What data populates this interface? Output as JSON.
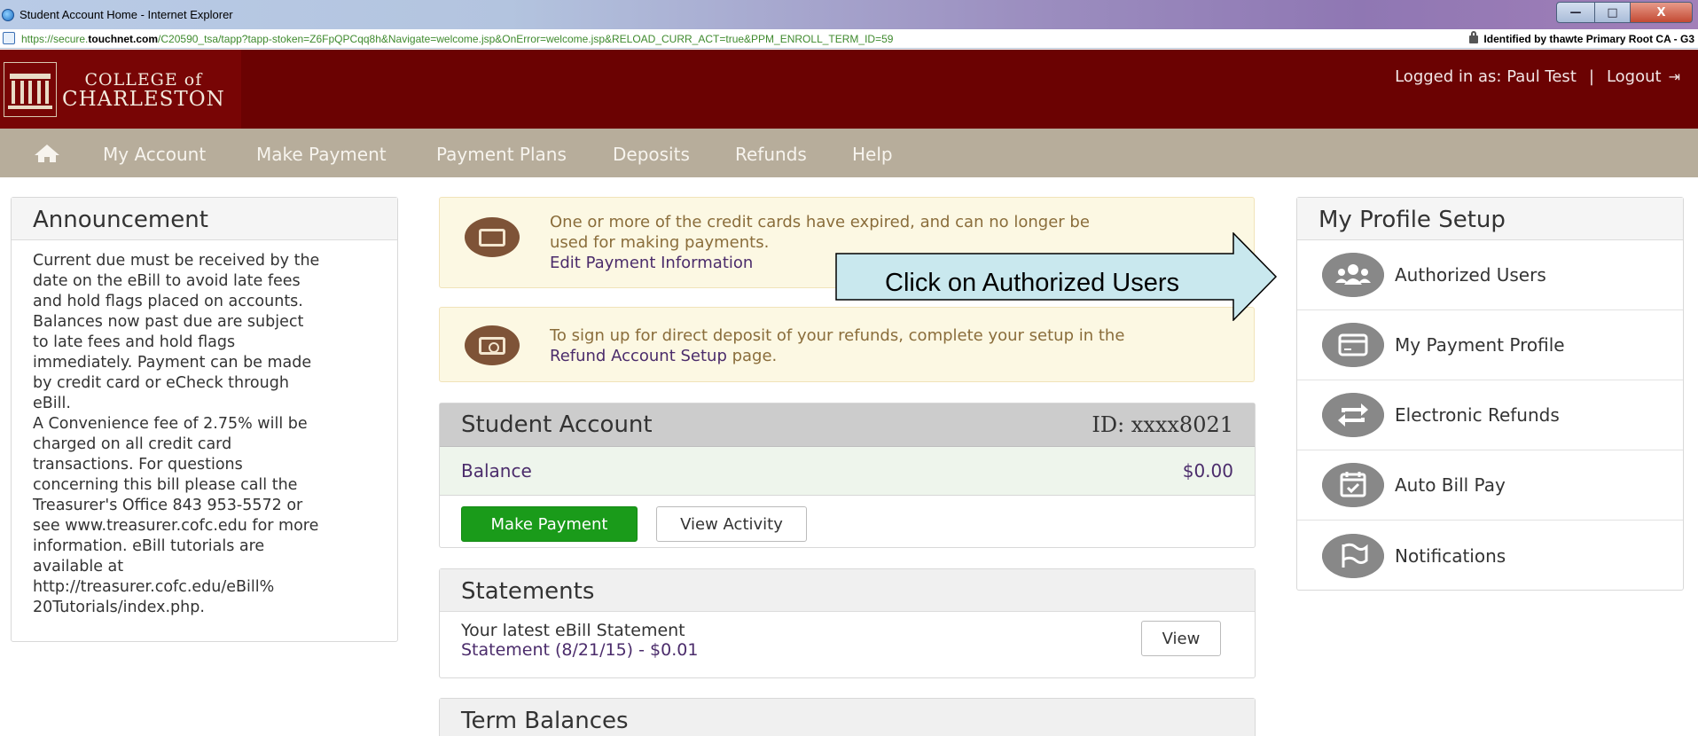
{
  "window": {
    "title": "Student Account Home - Internet Explorer",
    "url_scheme": "https://secure.",
    "url_host": "touchnet.com",
    "url_rest": "/C20590_tsa/tapp?tapp-stoken=Z6FpQPCqq8h&Navigate=welcome.jsp&OnError=welcome.jsp&RELOAD_CURR_ACT=true&PPM_ENROLL_TERM_ID=59",
    "cert_text": "Identified by thawte Primary Root CA - G3",
    "btn_min": "—",
    "btn_max": "□",
    "btn_close": "X"
  },
  "header": {
    "logo_line1": "COLLEGE of",
    "logo_line2": "CHARLESTON",
    "logged_in": "Logged in as: Paul Test",
    "separator": "|",
    "logout": "Logout",
    "logout_icon": "⇥"
  },
  "nav": {
    "items": [
      "My Account",
      "Make Payment",
      "Payment Plans",
      "Deposits",
      "Refunds",
      "Help"
    ]
  },
  "announcement": {
    "title": "Announcement",
    "body_lines": [
      "Current due must be received by the",
      "date on the eBill to avoid late fees",
      "and hold flags placed on accounts.",
      "Balances now past due are subject",
      "to late fees and hold flags",
      "immediately. Payment can be made",
      "by credit card or eCheck through",
      "eBill.",
      "A Convenience fee of 2.75% will be",
      "charged on all credit card",
      "transactions. For questions",
      "concerning this bill please call the",
      "Treasurer's Office 843 953-5572 or",
      "see www.treasurer.cofc.edu for more",
      "information. eBill tutorials are",
      "available at",
      "http://treasurer.cofc.edu/eBill%",
      "20Tutorials/index.php."
    ]
  },
  "alerts": {
    "expired_line1": "One or more of the credit cards have expired, and can no longer be",
    "expired_line2": "used for making payments.",
    "expired_link": "Edit Payment Information",
    "deposit_text": "To sign up for direct deposit of your refunds, complete your setup in the",
    "deposit_link": "Refund Account Setup",
    "deposit_suffix": " page."
  },
  "callout": {
    "text": "Click on Authorized Users"
  },
  "student_account": {
    "title": "Student Account",
    "id": "ID: xxxx8021",
    "balance_label": "Balance",
    "balance_value": "$0.00",
    "make_payment": "Make Payment",
    "view_activity": "View Activity"
  },
  "statements": {
    "title": "Statements",
    "latest_label": "Your latest eBill Statement",
    "latest_link": "Statement (8/21/15) - $0.01",
    "view": "View"
  },
  "term_balances": {
    "title": "Term Balances"
  },
  "profile_setup": {
    "title": "My Profile Setup",
    "items": [
      "Authorized Users",
      "My Payment Profile",
      "Electronic Refunds",
      "Auto Bill Pay",
      "Notifications"
    ]
  },
  "colors": {
    "header_bg": "#6b0202",
    "nav_bg": "#b7ad9b",
    "primary_button": "#1a9b1a",
    "link": "#4b2c6b",
    "callout_fill": "#c9e8ee"
  }
}
